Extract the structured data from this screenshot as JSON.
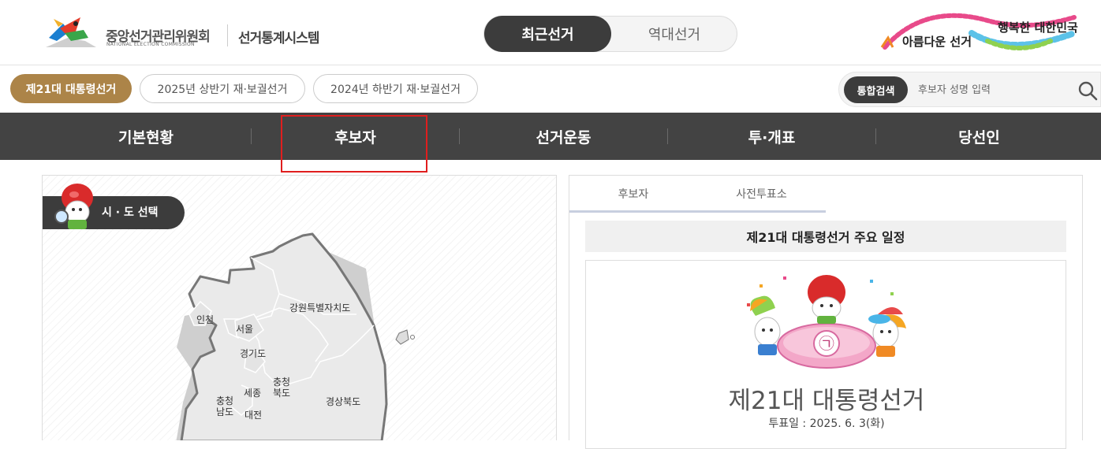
{
  "header": {
    "logo_ko": "중앙선거관리위원회",
    "logo_en": "NATIONAL ELECTION COMMISSION",
    "system_title": "선거통계시스템",
    "toggle": {
      "active": "최근선거",
      "inactive": "역대선거"
    },
    "slogan": {
      "left": "아름다운 선거",
      "right": "행복한 대한민국"
    }
  },
  "elections": [
    {
      "label": "제21대 대통령선거",
      "active": true
    },
    {
      "label": "2025년 상반기 재·보궐선거",
      "active": false
    },
    {
      "label": "2024년 하반기 재·보궐선거",
      "active": false
    }
  ],
  "search": {
    "button": "통합검색",
    "placeholder": "후보자 성명 입력"
  },
  "gnb": [
    "기본현황",
    "후보자",
    "선거운동",
    "투·개표",
    "당선인"
  ],
  "map": {
    "title": "시 · 도 선택",
    "regions": {
      "incheon": "인천",
      "seoul": "서울",
      "gyeonggi": "경기도",
      "gangwon": "강원특별자치도",
      "chungbuk_1": "충청",
      "chungbuk_2": "북도",
      "chungnam_1": "충청",
      "chungnam_2": "남도",
      "sejong": "세종",
      "daejeon": "대전",
      "gyeongbuk": "경상북도"
    }
  },
  "right": {
    "tabs": [
      "후보자",
      "사전투표소"
    ],
    "schedule_title": "제21대 대통령선거 주요 일정",
    "election_name": "제21대 대통령선거",
    "election_date": "투표일 : 2025. 6. 3(화)",
    "ballot_mark": "㉠"
  },
  "colors": {
    "accent": "#ac8448",
    "nav_bg": "#434343",
    "toggle_active": "#3c3c3c",
    "highlight": "#e01e1e"
  }
}
